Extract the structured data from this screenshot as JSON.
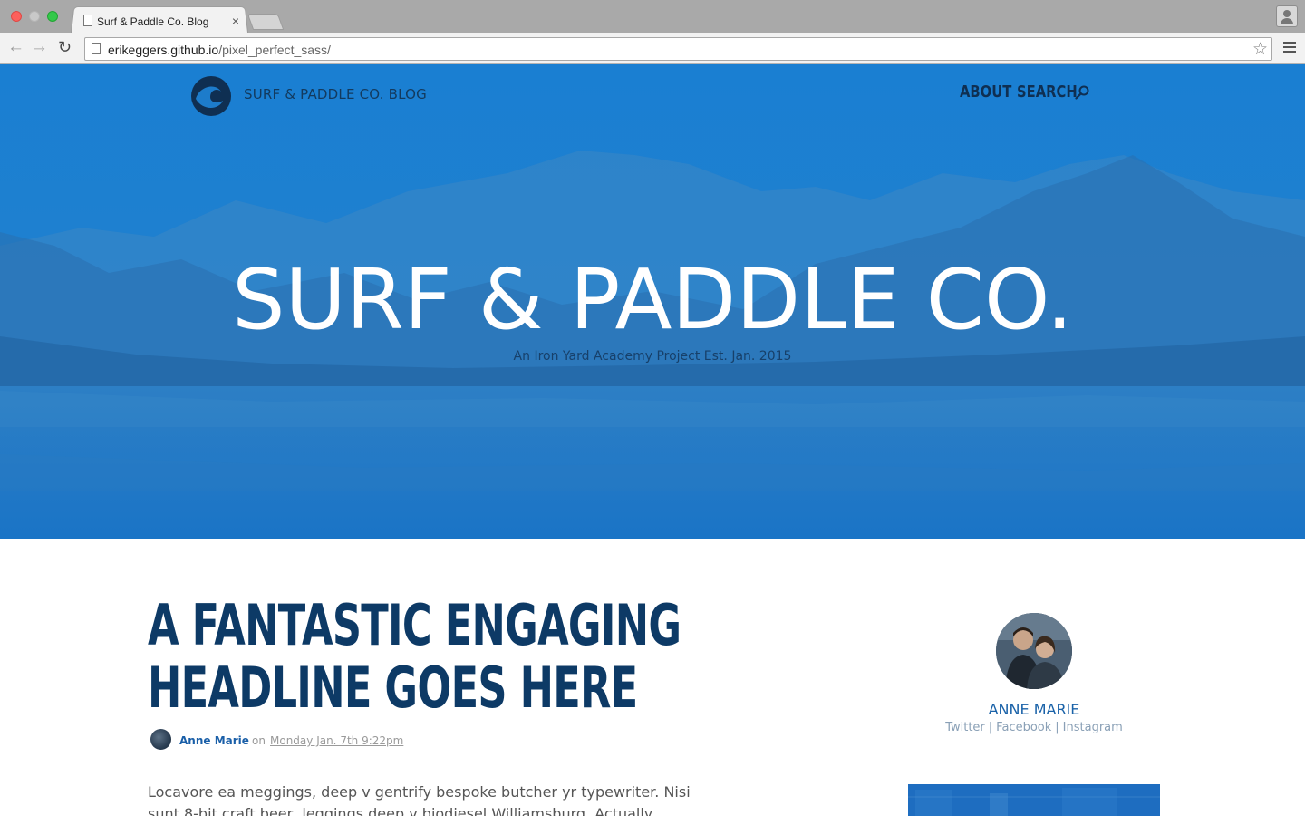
{
  "browser": {
    "tab_title": "Surf & Paddle Co. Blog",
    "url_host": "erikeggers.github.io",
    "url_path": "/pixel_perfect_sass/",
    "close_glyph": "×",
    "back_glyph": "←",
    "forward_glyph": "→",
    "reload_glyph": "↻",
    "star_glyph": "☆"
  },
  "site": {
    "logo_icon": "wave-logo-icon",
    "name": "SURF & PADDLE CO. BLOG",
    "nav": {
      "about": "ABOUT",
      "search": "SEARCH"
    }
  },
  "hero": {
    "title": "SURF & PADDLE CO.",
    "subtitle": "An Iron Yard Academy Project Est. Jan. 2015"
  },
  "article": {
    "headline": "A FANTASTIC ENGAGING HEADLINE GOES HERE",
    "author": "Anne Marie",
    "on": "on",
    "date": "Monday Jan. 7th 9:22pm",
    "body": "Locavore ea meggings, deep v gentrify bespoke butcher yr typewriter. Nisi sunt 8-bit craft beer, leggings deep v biodiesel Williamsburg. Actually hashtag art party nesciunt"
  },
  "sidebar": {
    "author_name": "ANNE MARIE",
    "social": {
      "twitter": "Twitter",
      "facebook": "Facebook",
      "instagram": "Instagram",
      "separator": "|"
    }
  },
  "colors": {
    "hero_blue": "#1d7ccb",
    "navy": "#0d3a66",
    "link_blue": "#1a62a8"
  }
}
